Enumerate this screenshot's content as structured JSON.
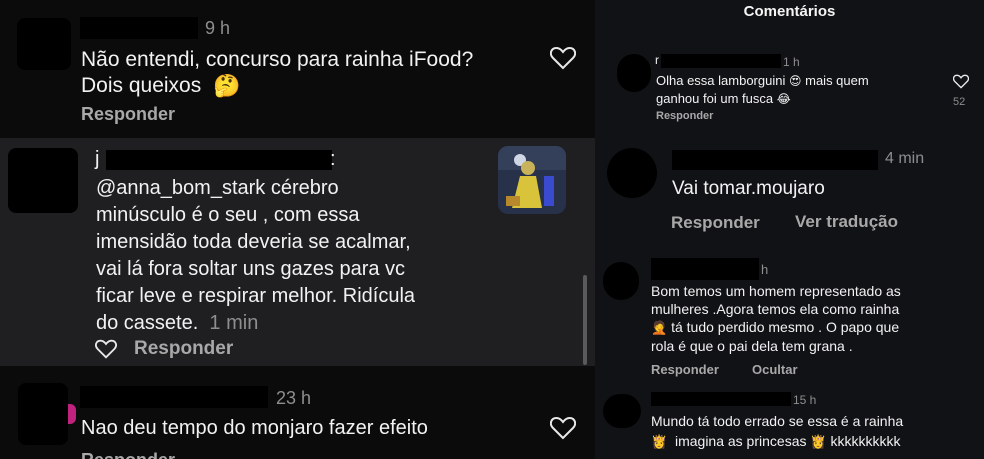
{
  "left": {
    "comments": [
      {
        "time": "9 h",
        "lines": [
          "Não entendi, concurso para rainha iFood?",
          "Dois queixos"
        ],
        "emoji": "🤔",
        "reply_label": "Responder"
      },
      {
        "username_initial": "j",
        "username_tail": ":",
        "lines": [
          "@anna_bom_stark cérebro",
          "minúsculo é o seu , com essa",
          "imensidão toda deveria se acalmar,",
          "vai lá fora soltar uns gazes para vc",
          "ficar leve e respirar melhor.  Ridícula",
          "do cassete."
        ],
        "time": "1 min",
        "reply_label": "Responder"
      },
      {
        "time": "23 h",
        "lines": [
          "Nao deu tempo  do monjaro  fazer  efeito"
        ],
        "reply_label": "Responder"
      }
    ]
  },
  "right": {
    "header": "Comentários",
    "comments": [
      {
        "time": "1 h",
        "line1": "Olha essa lamborguini",
        "emoji1": "😍",
        "line1b": "mais quem",
        "line2": "ganhou foi um fusca",
        "emoji2": "😂",
        "likes": "52",
        "reply_label": "Responder"
      },
      {
        "time": "4 min",
        "text": "Vai tomar.moujaro",
        "reply_label": "Responder",
        "translate_label": "Ver tradução"
      },
      {
        "time": "h",
        "lines": [
          "Bom temos um homem representado as",
          "mulheres .Agora temos ela como rainha",
          "tá tudo perdido mesmo . O papo que",
          "rola é que o pai dela tem grana ."
        ],
        "emoji": "🤦",
        "reply_label": "Responder",
        "hide_label": "Ocultar"
      },
      {
        "time": "15 h",
        "line1": "Mundo tá todo errado se essa é a rainha",
        "emoji1": "👸",
        "line2": "imagina as princesas",
        "emoji2": "👸",
        "line2b": "kkkkkkkkkk"
      }
    ]
  },
  "colors": {
    "left_bg": "#0b0b0b",
    "highlight_bg": "#1f1f22",
    "right_bg": "#111216",
    "muted_text": "#a8a8a8",
    "time_text": "#8e8e8e"
  }
}
